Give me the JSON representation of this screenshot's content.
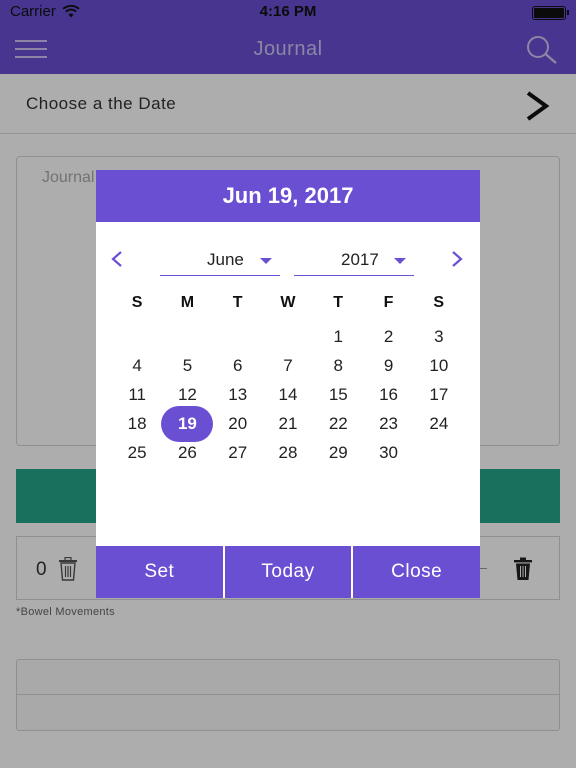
{
  "status_bar": {
    "carrier": "Carrier",
    "time": "4:16 PM"
  },
  "nav": {
    "title": "Journal",
    "menu_icon": "hamburger-menu-icon",
    "search_icon": "search-icon"
  },
  "date_row": {
    "label": "Choose a the Date"
  },
  "journal": {
    "placeholder": "Journal"
  },
  "bowel": {
    "count": "0",
    "caption": "*Bowel Movements"
  },
  "picker": {
    "header": "Jun 19, 2017",
    "month": "June",
    "year": "2017",
    "weekdays": [
      "S",
      "M",
      "T",
      "W",
      "T",
      "F",
      "S"
    ],
    "first_weekday_index": 4,
    "days_in_month": 30,
    "selected_day": 19,
    "buttons": {
      "set": "Set",
      "today": "Today",
      "close": "Close"
    }
  },
  "colors": {
    "primary": "#6a4fd3",
    "accent_green": "#26a58a"
  }
}
